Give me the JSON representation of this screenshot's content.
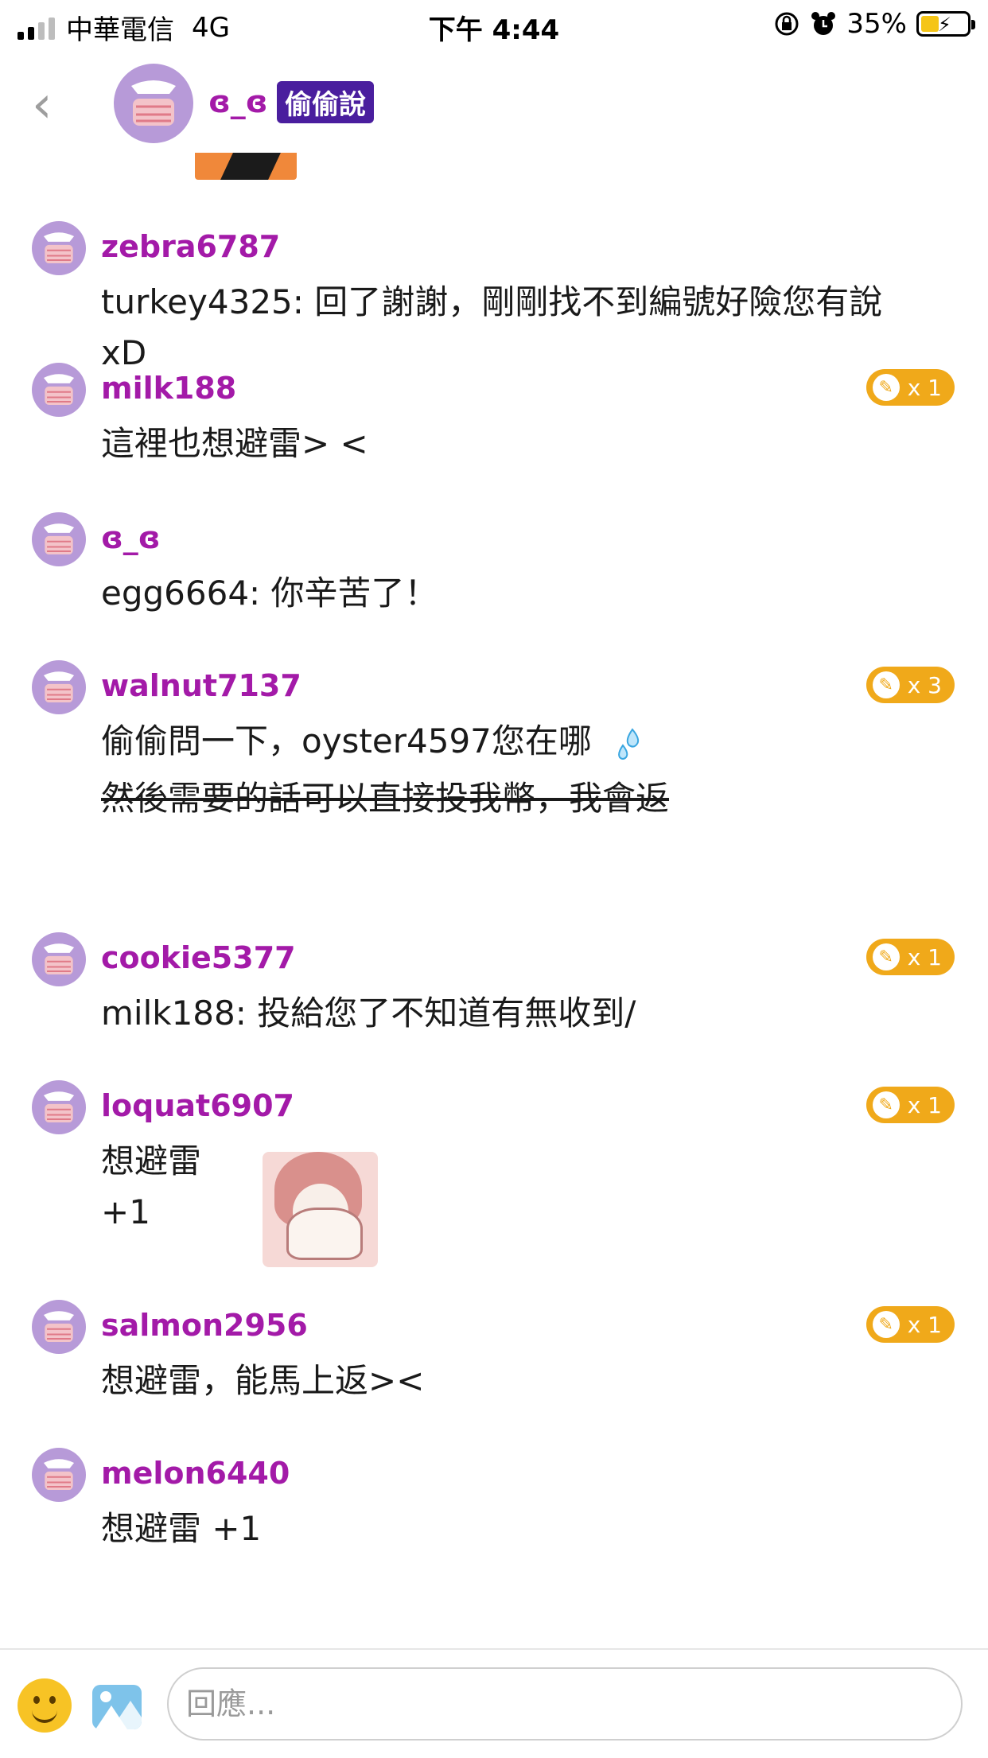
{
  "status_bar": {
    "carrier": "中華電信",
    "network": "4G",
    "time": "下午 4:44",
    "battery_pct": "35%",
    "battery_fill_fraction": 0.35,
    "icons": [
      "signal-icon",
      "orientation-lock-icon",
      "alarm-icon",
      "battery-charging-icon"
    ]
  },
  "header": {
    "back_icon": "chevron-left-icon",
    "author": "ʚ̴̶̷̷_ʚ̴̶̷̷",
    "author_display": "ɞ_ɞ",
    "board_badge": "偷偷說"
  },
  "comments": [
    {
      "user": "zebra6787",
      "lines": [
        "turkey4325: 回了謝謝，剛剛找不到編號好險您有說",
        "xD"
      ]
    },
    {
      "user": "milk188",
      "likes": "x 1",
      "lines": [
        "這裡也想避雷> <"
      ]
    },
    {
      "user": "ɞ_ɞ",
      "lines": [
        "egg6664: 你辛苦了！"
      ]
    },
    {
      "user": "walnut7137",
      "likes": "x 3",
      "lines": [
        "偷偷問一下，oyster4597您在哪"
      ],
      "struck": "然後需要的話可以直接投我幣，我會返"
    },
    {
      "user": "cookie5377",
      "likes": "x 1",
      "lines": [
        "milk188: 投給您了不知道有無收到/"
      ]
    },
    {
      "user": "loquat6907",
      "likes": "x 1",
      "lines": [
        "想避雷 +1"
      ]
    },
    {
      "user": "salmon2956",
      "likes": "x 1",
      "lines": [
        "想避雷，能馬上返><"
      ]
    },
    {
      "user": "melon6440",
      "lines": [
        "想避雷 +1"
      ]
    }
  ],
  "reply_bar": {
    "placeholder": "回應...",
    "value": "",
    "colors": {
      "username": "#a31aa8",
      "badge": "#4a1e9e",
      "likes_pill": "#f0a91a"
    }
  }
}
